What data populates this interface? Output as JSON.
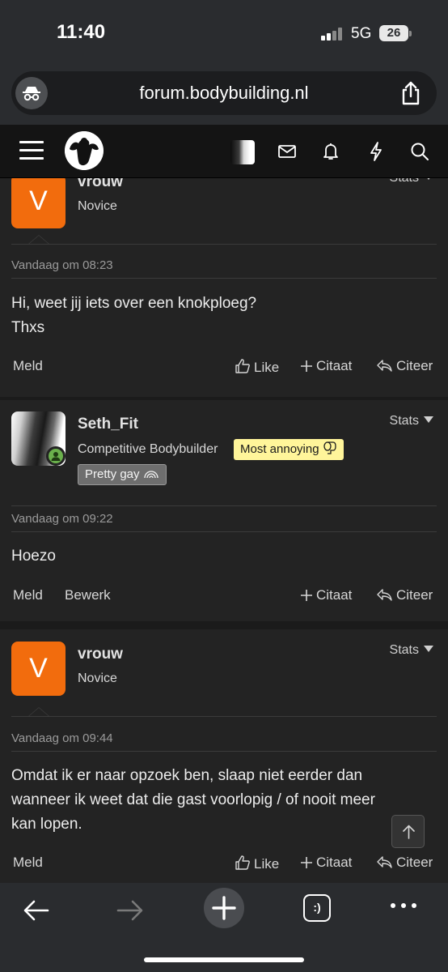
{
  "status_bar": {
    "time": "11:40",
    "network": "5G",
    "battery": "26"
  },
  "browser": {
    "url": "forum.bodybuilding.nl"
  },
  "header": {
    "icons": [
      "menu-icon",
      "logo",
      "avatar",
      "mail-icon",
      "bell-icon",
      "lightning-icon",
      "search-icon"
    ]
  },
  "posts": [
    {
      "username": "vrouw",
      "avatar_letter": "V",
      "title": "Novice",
      "stats_label": "Stats",
      "date": "Vandaag om 08:23",
      "body": [
        "Hi, weet jij iets over een knokploeg?",
        "Thxs"
      ],
      "actions": {
        "report": "Meld",
        "like": "Like",
        "quote": "Citaat",
        "reply": "Citeer"
      }
    },
    {
      "username": "Seth_Fit",
      "title": "Competitive Bodybuilder",
      "badge_primary": "Most annoying",
      "badge_secondary": "Pretty gay",
      "stats_label": "Stats",
      "date": "Vandaag om 09:22",
      "body": [
        "Hoezo"
      ],
      "actions": {
        "report": "Meld",
        "edit": "Bewerk",
        "quote": "Citaat",
        "reply": "Citeer"
      }
    },
    {
      "username": "vrouw",
      "avatar_letter": "V",
      "title": "Novice",
      "stats_label": "Stats",
      "date": "Vandaag om 09:44",
      "body": [
        "Omdat ik er naar opzoek ben, slaap niet eerder dan",
        "wanneer ik weet dat die gast voorlopig / of nooit meer",
        "kan lopen."
      ],
      "actions": {
        "report": "Meld",
        "like": "Like",
        "quote": "Citaat",
        "reply": "Citeer"
      }
    }
  ],
  "colors": {
    "accent_orange": "#f26c0d",
    "badge_yellow": "#fff59a",
    "online_green": "#6ab04c"
  }
}
